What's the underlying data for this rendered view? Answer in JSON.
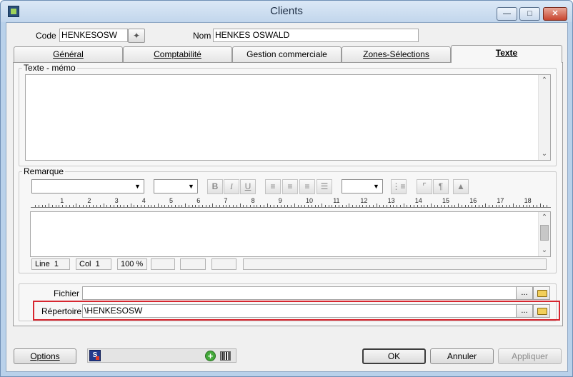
{
  "window": {
    "title": "Clients"
  },
  "header": {
    "code_label": "Code",
    "code_value": "HENKESOSW",
    "nom_label": "Nom",
    "nom_value": "HENKES OSWALD"
  },
  "tabs": [
    {
      "label": "Général",
      "active": false
    },
    {
      "label": "Comptabilité",
      "active": false
    },
    {
      "label": "Gestion commerciale",
      "active": false
    },
    {
      "label": "Zones-Sélections",
      "active": false
    },
    {
      "label": "Texte",
      "active": true
    }
  ],
  "texte_memo": {
    "title": "Texte - mémo",
    "value": ""
  },
  "remarque": {
    "title": "Remarque",
    "toolbar": {
      "bold": "B",
      "italic": "I",
      "underline": "U"
    },
    "ruler_numbers": [
      "1",
      "2",
      "3",
      "4",
      "5",
      "6",
      "7",
      "8",
      "9",
      "10",
      "11",
      "12",
      "13",
      "14",
      "15",
      "16",
      "17",
      "18"
    ],
    "status": {
      "line_label": "Line",
      "line_value": "1",
      "col_label": "Col",
      "col_value": "1",
      "zoom": "100 %"
    }
  },
  "files": {
    "fichier_label": "Fichier",
    "fichier_value": "",
    "repertoire_label": "Répertoire",
    "repertoire_value": "\\HENKESOSW",
    "browse_label": "..."
  },
  "buttons": {
    "options": "Options",
    "ok": "OK",
    "annuler": "Annuler",
    "appliquer": "Appliquer"
  },
  "icons": {
    "s_icon_letter": "S"
  },
  "colors": {
    "highlight": "#d7262f",
    "titlebar": "#c2d6ec"
  }
}
